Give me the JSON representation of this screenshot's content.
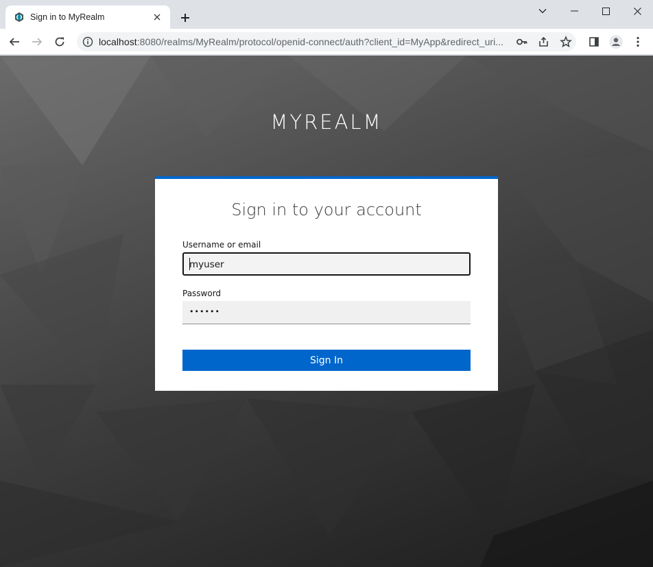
{
  "browser": {
    "tab_title": "Sign in to MyRealm",
    "url_host": "localhost",
    "url_rest": ":8080/realms/MyRealm/protocol/openid-connect/auth?client_id=MyApp&redirect_uri..."
  },
  "page": {
    "realm_name": "MYREALM",
    "card_title": "Sign in to your account",
    "username_label": "Username or email",
    "username_value": "myuser",
    "password_label": "Password",
    "password_value": "••••••",
    "signin_label": "Sign In"
  },
  "colors": {
    "accent": "#0066cc"
  },
  "icons": {
    "favicon": "keycloak-icon",
    "back": "arrow-left-icon",
    "forward": "arrow-right-icon",
    "reload": "reload-icon",
    "site_info": "info-icon",
    "key": "key-icon",
    "share": "share-icon",
    "bookmark": "star-icon",
    "sidepanel": "sidepanel-icon",
    "profile": "profile-icon",
    "menu": "kebab-menu-icon"
  }
}
